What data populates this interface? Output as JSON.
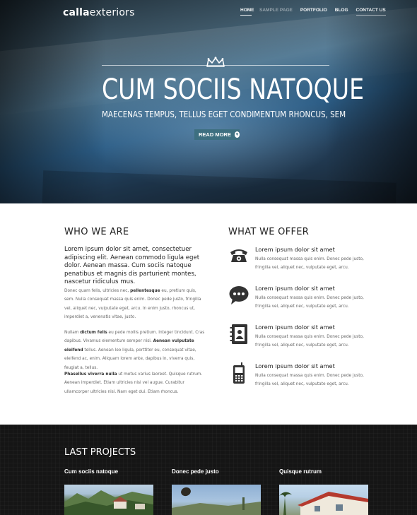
{
  "header": {
    "logo_bold": "calla",
    "logo_regular": "exteriors",
    "nav": [
      {
        "label": "HOME",
        "active": true
      },
      {
        "label": "SAMPLE PAGE",
        "ghost": true
      },
      {
        "label": "PORTFOLIO"
      },
      {
        "label": "BLOG"
      },
      {
        "label": "CONTACT US"
      }
    ]
  },
  "hero": {
    "title": "CUM SOCIIS NATOQUE",
    "subtitle": "MAECENAS TEMPUS, TELLUS EGET CONDIMENTUM RHONCUS, SEM",
    "button_label": "READ MORE",
    "button_icon": "chevron-down-icon"
  },
  "who": {
    "title": "WHO WE ARE",
    "lead": "Lorem ipsum dolor sit amet, consectetuer adipiscing elit. Aenean commodo ligula eget dolor. Aenean massa. Cum sociis natoque penatibus et magnis dis parturient montes, nascetur ridiculus mus.",
    "p1_a": "Donec quam felis, ultricies nec, ",
    "p1_b": "pellentesque",
    "p1_c": " eu, pretium quis, sem. Nulla consequat massa quis enim. Donec pede justo, fringilla vel, aliquet nec, vulputate eget, arcu. In enim justo, rhoncus ut, imperdiet a, venenatis vitae, justo.",
    "p2_a": "Nullam ",
    "p2_b": "dictum felis",
    "p2_c": " eu pede mollis pretium. Integer tincidunt. Cras dapibus. Vivamus elementum semper nisi. ",
    "p2_d": "Aenean vulputate eleifend",
    "p2_e": " tellus. Aenean leo ligula, porttitor eu, consequat vitae, eleifend ac, enim. Aliquam lorem ante, dapibus in, viverra quis, feugiat a, tellus.",
    "p3_a": "Phasellus viverra nulla",
    "p3_b": " ut metus varius laoreet. Quisque rutrum. Aenean imperdiet. Etiam ultricies nisi vel augue. Curabitur ullamcorper ultricies nisi. Nam eget dui. Etiam rhoncus."
  },
  "offer": {
    "title": "WHAT WE OFFER",
    "items": [
      {
        "icon": "phone-icon",
        "title": "Lorem ipsum dolor sit amet",
        "text": "Nulla consequat massa quis enim. Donec pede justo, fringilla vel, aliquet nec, vulputate eget, arcu."
      },
      {
        "icon": "chat-bubble-icon",
        "title": "Lorem ipsum dolor sit amet",
        "text": "Nulla consequat massa quis enim. Donec pede justo, fringilla vel, aliquet nec, vulputate eget, arcu."
      },
      {
        "icon": "address-book-icon",
        "title": "Lorem ipsum dolor sit amet",
        "text": "Nulla consequat massa quis enim. Donec pede justo, fringilla vel, aliquet nec, vulputate eget, arcu."
      },
      {
        "icon": "mobile-phone-icon",
        "title": "Lorem ipsum dolor sit amet",
        "text": "Nulla consequat massa quis enim. Donec pede justo, fringilla vel, aliquet nec, vulputate eget, arcu."
      }
    ]
  },
  "projects": {
    "title": "LAST PROJECTS",
    "items": [
      {
        "title": "Cum sociis natoque"
      },
      {
        "title": "Donec pede justo"
      },
      {
        "title": "Quisque rutrum"
      }
    ]
  },
  "colors": {
    "accent": "#3d6f80",
    "dark_bg": "#151515",
    "text": "#222222"
  }
}
